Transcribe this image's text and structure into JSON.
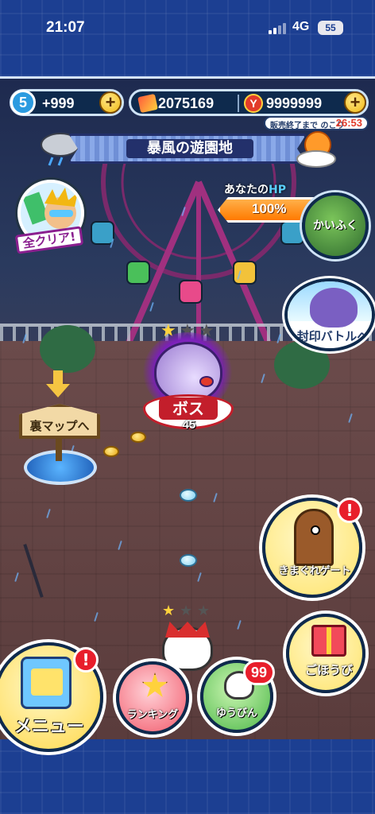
{
  "status_bar": {
    "time": "21:07",
    "network": "4G",
    "battery": "55"
  },
  "hud": {
    "stamina_level": "5",
    "stamina_value": "+999",
    "coins_value": "2075169",
    "ycoin_value": "9999999",
    "plus_label": "+",
    "event_label": "販売終了まで のこり",
    "event_time": "26:53"
  },
  "stage": {
    "title": "暴風の遊園地"
  },
  "all_clear": {
    "label": "全クリア!"
  },
  "hp": {
    "label_prefix": "あなたの",
    "label_hp": "HP",
    "value": "100%",
    "fraction": 1.0,
    "heal_label": "かいふく"
  },
  "seal_battle": {
    "label": "封印バトルへ"
  },
  "boss": {
    "label": "ボス",
    "level": "45",
    "stars": [
      "★",
      "★",
      "★"
    ]
  },
  "map_sign": {
    "label": "裏マップへ"
  },
  "gate": {
    "label": "きまぐれゲート",
    "alert": "!"
  },
  "reward": {
    "label": "ごほうび"
  },
  "menu": {
    "label": "メニュー",
    "alert": "!"
  },
  "ranking": {
    "label": "ランキング"
  },
  "mail": {
    "label": "ゆうびん",
    "badge": "99"
  },
  "player": {
    "stars": [
      "★",
      "★",
      "★"
    ]
  },
  "colors": {
    "accent": "#ffd84a",
    "hp_fill": "#ff7a00",
    "boss_red": "#c31e2b",
    "badge_red": "#e81e2b",
    "frame": "#1c3f92"
  }
}
